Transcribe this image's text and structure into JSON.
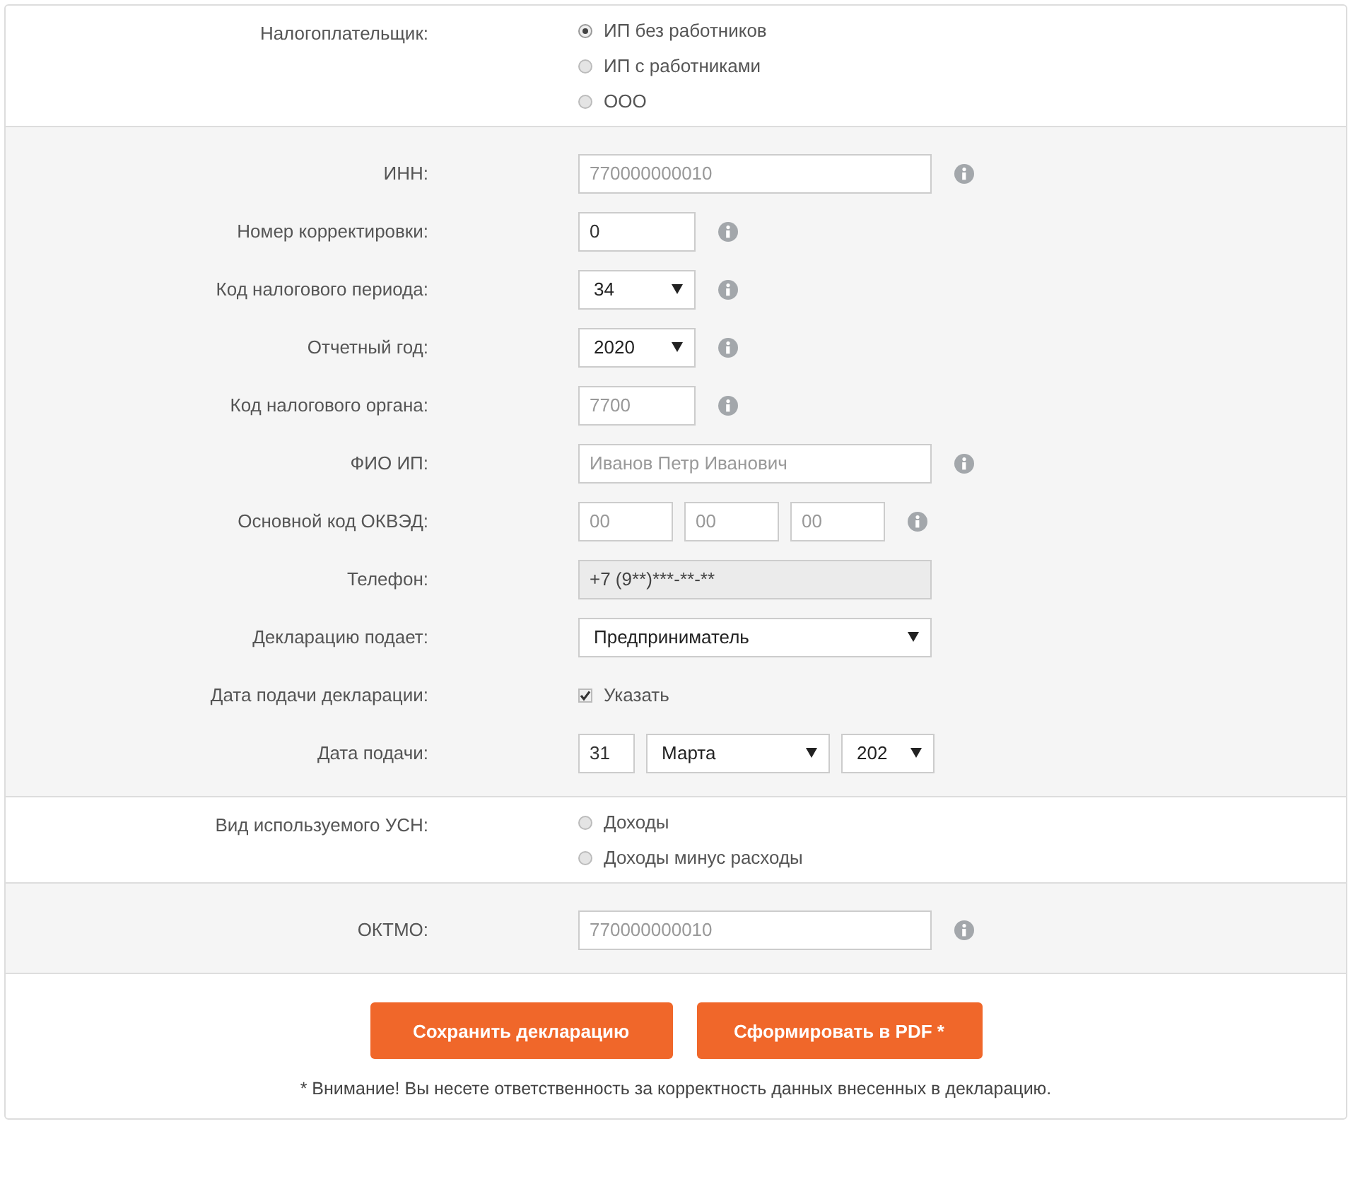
{
  "sections": [
    {
      "rows": [
        {
          "label": "Налогоплательщик:",
          "kind": "radio",
          "options": [
            {
              "label": "ИП без работников",
              "selected": true
            },
            {
              "label": "ИП с работниками",
              "selected": false
            },
            {
              "label": "ООО",
              "selected": false
            }
          ]
        }
      ]
    },
    {
      "rows": [
        {
          "label": "ИНН:",
          "kind": "wide",
          "info": true,
          "controls": [
            {
              "kind": "text",
              "placeholder": "770000000010",
              "disabled": false
            }
          ]
        },
        {
          "label": "Номер корректировки:",
          "kind": "short",
          "info": true,
          "controls": [
            {
              "kind": "text",
              "value": "0",
              "disabled": false
            }
          ]
        },
        {
          "label": "Код налогового периода:",
          "kind": "short",
          "info": true,
          "controls": [
            {
              "kind": "select",
              "value": "34"
            }
          ]
        },
        {
          "label": "Отчетный год:",
          "kind": "short",
          "info": true,
          "controls": [
            {
              "kind": "select",
              "value": "2020"
            }
          ]
        },
        {
          "label": "Код налогового органа:",
          "kind": "short",
          "info": true,
          "controls": [
            {
              "kind": "text",
              "placeholder": "7700",
              "disabled": false
            }
          ]
        },
        {
          "label": "ФИО ИП:",
          "kind": "wide",
          "info": true,
          "controls": [
            {
              "kind": "text",
              "placeholder": "Иванов Петр Иванович",
              "disabled": false
            }
          ]
        },
        {
          "label": "Основной код ОКВЭД:",
          "kind": "triple",
          "info": true,
          "controls": [
            {
              "kind": "text",
              "placeholder": "00",
              "disabled": false
            },
            {
              "kind": "text",
              "placeholder": "00",
              "disabled": false
            },
            {
              "kind": "text",
              "placeholder": "00",
              "disabled": false
            }
          ]
        },
        {
          "label": "Телефон:",
          "kind": "wide",
          "info": false,
          "controls": [
            {
              "kind": "text",
              "value": "+7 (9**)***-**-**",
              "disabled": true
            }
          ]
        },
        {
          "label": "Декларацию подает:",
          "kind": "wide",
          "info": false,
          "controls": [
            {
              "kind": "select",
              "value": "Предприниматель"
            }
          ]
        },
        {
          "label": "Дата подачи декларации:",
          "kind": "short",
          "info": false,
          "controls": [
            {
              "kind": "checkbox",
              "label": "Указать",
              "checked": true
            }
          ]
        },
        {
          "label": "Дата подачи:",
          "kind": "date",
          "info": false,
          "controls": [
            {
              "kind": "text",
              "value": "31",
              "disabled": false
            },
            {
              "kind": "select",
              "value": "Марта"
            },
            {
              "kind": "select",
              "value": "202"
            }
          ]
        }
      ]
    },
    {
      "rows": [
        {
          "label": "Вид используемого УСН:",
          "kind": "radio",
          "options": [
            {
              "label": "Доходы",
              "selected": false
            },
            {
              "label": "Доходы минус расходы",
              "selected": false
            }
          ]
        }
      ]
    },
    {
      "rows": [
        {
          "label": "ОКТМО:",
          "kind": "wide",
          "info": true,
          "controls": [
            {
              "kind": "text",
              "placeholder": "770000000010",
              "disabled": false
            }
          ]
        }
      ]
    }
  ],
  "buttons": [
    "Сохранить декларацию",
    "Сформировать в PDF *"
  ],
  "note": "* Внимание! Вы несете ответственность за корректность данных внесенных в декларацию."
}
